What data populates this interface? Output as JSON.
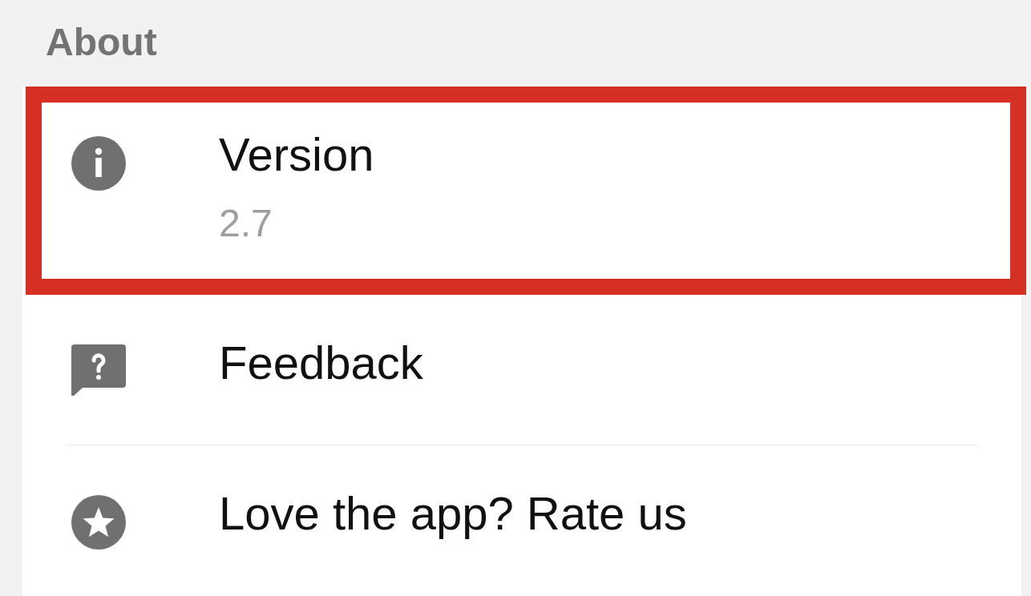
{
  "section": {
    "title": "About"
  },
  "items": [
    {
      "kind": "info",
      "title": "Version",
      "value": "2.7",
      "highlighted": true
    },
    {
      "kind": "feedback",
      "title": "Feedback",
      "highlighted": false
    },
    {
      "kind": "rating",
      "title": "Love the app? Rate us",
      "highlighted": false
    }
  ]
}
